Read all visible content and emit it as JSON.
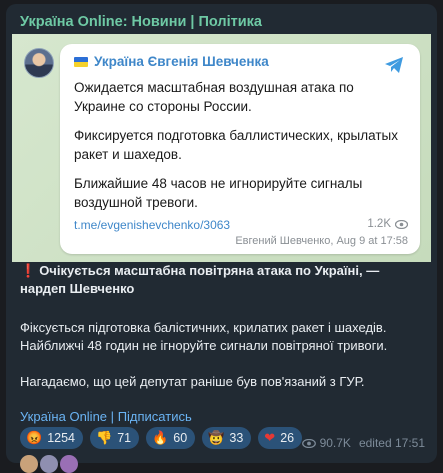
{
  "channel": {
    "title": "Україна Online: Новини | Політика"
  },
  "forwarded": {
    "sender": "Україна Євгенія Шевченка",
    "paragraphs": [
      "Ожидается масштабная воздушная атака по Украине со стороны России.",
      "Фиксируется подготовка баллистических, крылатых ракет и шахедов.",
      "Ближайшие 48 часов не игнорируйте сигналы воздушной тревоги."
    ],
    "link": "t.me/evgenishevchenko/3063",
    "views": "1.2K",
    "meta": "Евгений Шевченко, Aug 9 at 17:58"
  },
  "post": {
    "headline_mark": "❗",
    "headline": "Очікується масштабна повітряна атака по Україні, — нардеп Шевченко",
    "body1": "Фіксується підготовка балістичних, крилатих ракет і шахедів. Найближчі 48 годин не ігноруйте сигнали повітряної тривоги.",
    "body2": "Нагадаємо, що цей депутат раніше був пов'язаний з ГУР.",
    "footer_channel": "Україна Online",
    "footer_sep": "|",
    "footer_subscribe": "Підписатись"
  },
  "reactions": [
    {
      "icon": "angry-face-icon",
      "glyph": "😡",
      "count": "1254"
    },
    {
      "icon": "thumbs-down-icon",
      "glyph": "👎",
      "count": "71"
    },
    {
      "icon": "fire-icon",
      "glyph": "🔥",
      "count": "60"
    },
    {
      "icon": "cowboy-face-icon",
      "glyph": "🤠",
      "count": "33"
    },
    {
      "icon": "heart-icon",
      "glyph": "❤",
      "count": "26"
    }
  ],
  "post_meta": {
    "views": "90.7K",
    "edited": "edited 17:51"
  },
  "colors": {
    "accent": "#6ec9a4",
    "link": "#6ab3f3",
    "bubble_bg": "#212a33",
    "reaction_bg": "#2b5278"
  }
}
